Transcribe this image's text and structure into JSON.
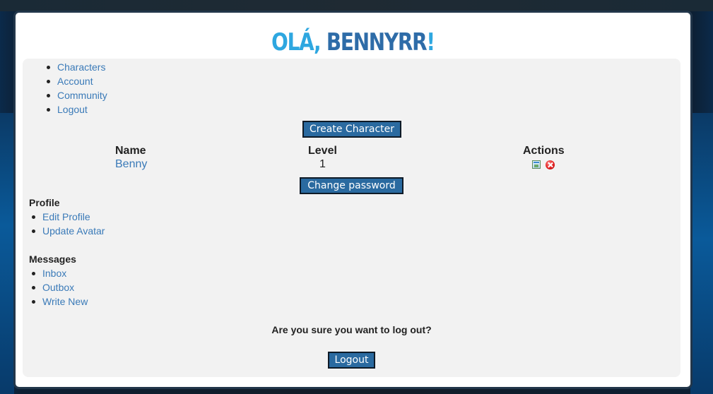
{
  "title": {
    "prefix": "OLÁ, ",
    "username": "BENNYRR",
    "suffix": "!"
  },
  "nav": {
    "items": [
      {
        "label": "Characters"
      },
      {
        "label": "Account"
      },
      {
        "label": "Community"
      },
      {
        "label": "Logout"
      }
    ]
  },
  "characters": {
    "create_button": "Create Character",
    "headers": {
      "name": "Name",
      "level": "Level",
      "actions": "Actions"
    },
    "rows": [
      {
        "name": "Benny",
        "level": "1",
        "actions": [
          "edit-icon",
          "delete-icon"
        ]
      }
    ]
  },
  "account": {
    "change_password_button": "Change password"
  },
  "profile": {
    "title": "Profile",
    "items": [
      {
        "label": "Edit Profile"
      },
      {
        "label": "Update Avatar"
      }
    ]
  },
  "messages": {
    "title": "Messages",
    "items": [
      {
        "label": "Inbox"
      },
      {
        "label": "Outbox"
      },
      {
        "label": "Write New"
      }
    ]
  },
  "logout": {
    "question": "Are you sure you want to log out?",
    "button": "Logout"
  },
  "colors": {
    "link": "#3a7ab8",
    "button_bg": "#2a6aa0",
    "title_light": "#2ea7e0",
    "title_dark": "#2e6ca8",
    "panel_bg": "#f2f2f2"
  }
}
